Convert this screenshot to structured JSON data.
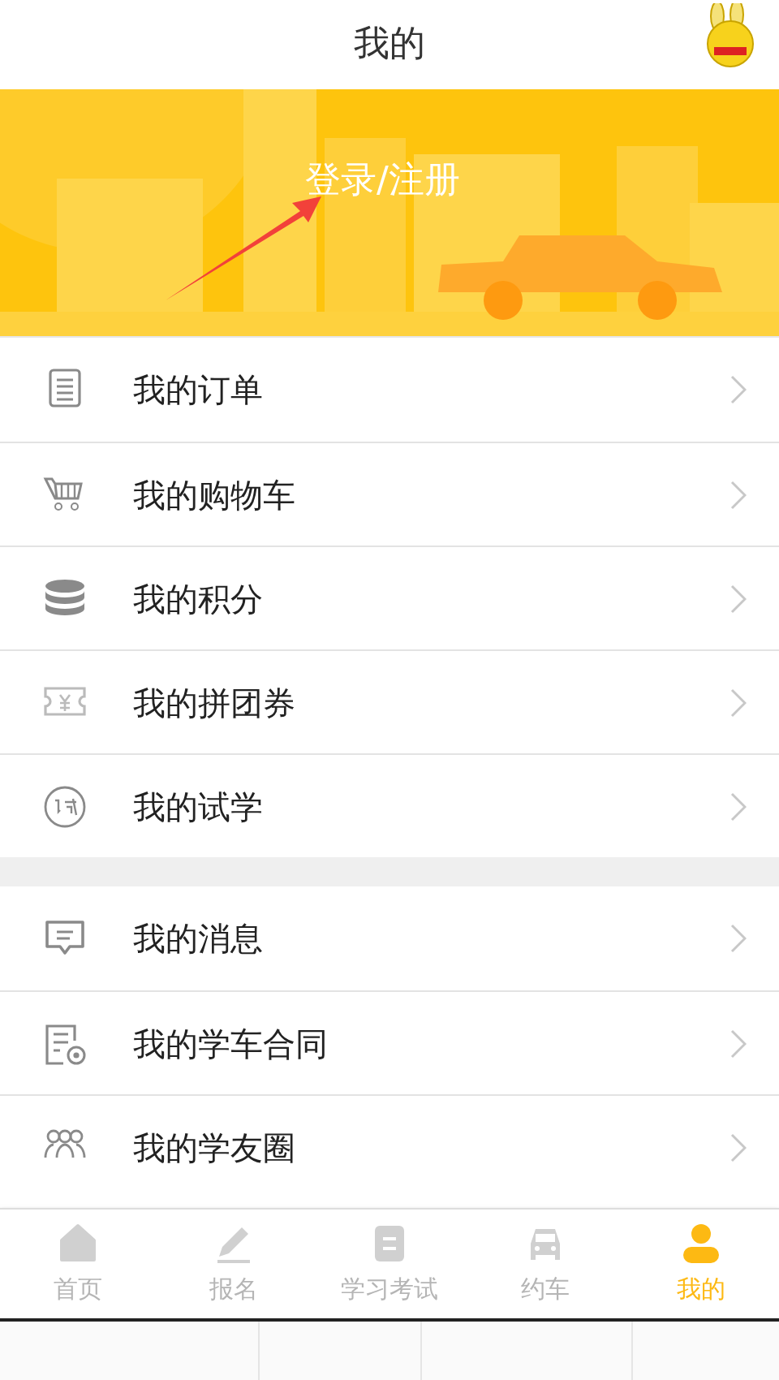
{
  "header": {
    "title": "我的"
  },
  "banner": {
    "login_link": "登录/注册"
  },
  "menu_groups": [
    [
      {
        "kind": "order",
        "label": "我的订单"
      },
      {
        "kind": "cart",
        "label": "我的购物车"
      },
      {
        "kind": "coins",
        "label": "我的积分"
      },
      {
        "kind": "coupon",
        "label": "我的拼团券"
      },
      {
        "kind": "trial",
        "label": "我的试学"
      }
    ],
    [
      {
        "kind": "message",
        "label": "我的消息"
      },
      {
        "kind": "contract",
        "label": "我的学车合同"
      },
      {
        "kind": "friends",
        "label": "我的学友圈"
      }
    ]
  ],
  "tab_bar": [
    {
      "kind": "home",
      "label": "首页",
      "selected": false
    },
    {
      "kind": "pen",
      "label": "报名",
      "selected": false
    },
    {
      "kind": "exam",
      "label": "学习考试",
      "selected": false
    },
    {
      "kind": "car",
      "label": "约车",
      "selected": false
    },
    {
      "kind": "person",
      "label": "我的",
      "selected": true
    }
  ]
}
